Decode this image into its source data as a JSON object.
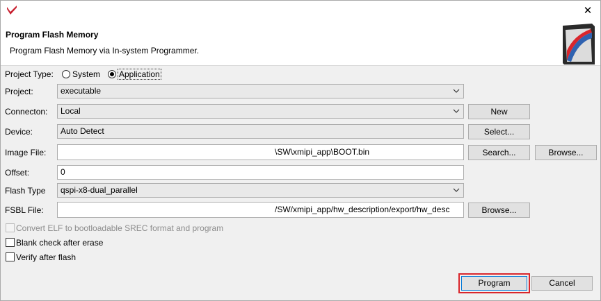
{
  "dialog": {
    "header_title": "Program Flash Memory",
    "header_subtitle": "Program Flash Memory via In-system Programmer."
  },
  "form": {
    "project_type": {
      "label": "Project Type:",
      "options": [
        "System",
        "Application"
      ],
      "selected": "Application"
    },
    "project": {
      "label": "Project:",
      "value": "executable"
    },
    "connection": {
      "label": "Connecton:",
      "value": "Local",
      "button": "New"
    },
    "device": {
      "label": "Device:",
      "value": "Auto Detect",
      "button": "Select..."
    },
    "image_file": {
      "label": "Image File:",
      "value": "\\SW\\xmipi_app\\BOOT.bin",
      "search_button": "Search...",
      "browse_button": "Browse..."
    },
    "offset": {
      "label": "Offset:",
      "value": "0"
    },
    "flash_type": {
      "label": "Flash Type",
      "value": "qspi-x8-dual_parallel"
    },
    "fsbl_file": {
      "label": "FSBL File:",
      "value": "/SW/xmipi_app/hw_description/export/hw_desc",
      "browse_button": "Browse..."
    },
    "options": {
      "convert_elf": {
        "label": "Convert ELF to bootloadable SREC format and program",
        "checked": false,
        "enabled": false
      },
      "blank_check": {
        "label": "Blank check after erase",
        "checked": false,
        "enabled": true
      },
      "verify": {
        "label": "Verify after flash",
        "checked": false,
        "enabled": true
      }
    }
  },
  "buttons": {
    "program": "Program",
    "cancel": "Cancel"
  },
  "colors": {
    "highlight": "#d9262c",
    "logo_blue": "#2f62b0",
    "logo_red": "#d9262c"
  }
}
